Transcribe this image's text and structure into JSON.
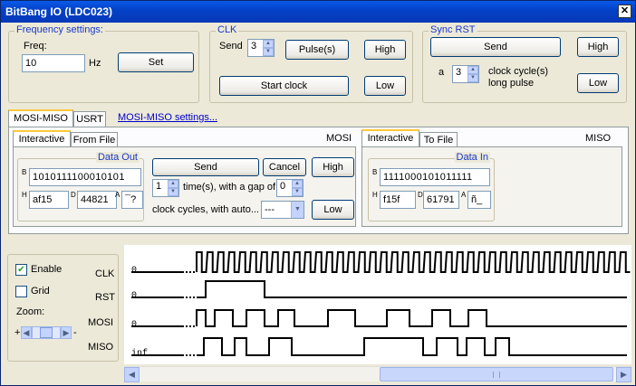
{
  "window": {
    "title": "BitBang IO (LDC023)",
    "close_glyph": "✕"
  },
  "frequency": {
    "group_title": "Frequency settings:",
    "freq_label": "Freq:",
    "freq_value": "10",
    "unit": "Hz",
    "set_label": "Set"
  },
  "clk": {
    "group_title": "CLK",
    "send_label": "Send",
    "send_count": "3",
    "pulses_label": "Pulse(s)",
    "high_label": "High",
    "start_clock_label": "Start clock",
    "low_label": "Low"
  },
  "sync_rst": {
    "group_title": "Sync RST",
    "send_label": "Send",
    "high_label": "High",
    "a_label": "a",
    "cycles_value": "3",
    "cycles_label_1": "clock cycle(s)",
    "cycles_label_2": "long pulse",
    "low_label": "Low"
  },
  "main_tabs": [
    {
      "label": "MOSI-MISO",
      "active": true
    },
    {
      "label": "USRT",
      "active": false
    }
  ],
  "settings_link": "MOSI-MISO settings...",
  "mosi": {
    "section_label": "MOSI",
    "tabs": [
      {
        "label": "Interactive",
        "active": true
      },
      {
        "label": "From File",
        "active": false
      }
    ],
    "data_out_title": "Data Out",
    "b_label": "B",
    "binary": "1010111100010101",
    "h_label": "H",
    "hex": "af15",
    "d_label": "D",
    "dec": "44821",
    "a_label": "A",
    "ascii": "¯?",
    "send_label": "Send",
    "cancel_label": "Cancel",
    "high_label": "High",
    "times_value": "1",
    "times_label": "time(s), with a gap of",
    "gap_value": "0",
    "cycles_label": "clock cycles, with auto...",
    "auto_value": "---",
    "low_label": "Low"
  },
  "miso": {
    "section_label": "MISO",
    "tabs": [
      {
        "label": "Interactive",
        "active": true
      },
      {
        "label": "To File",
        "active": false
      }
    ],
    "data_in_title": "Data In",
    "b_label": "B",
    "binary": "1111000101011111",
    "h_label": "H",
    "hex": "f15f",
    "d_label": "D",
    "dec": "61791",
    "a_label": "A",
    "ascii": "ñ_"
  },
  "view": {
    "enable_label": "Enable",
    "enable_checked": true,
    "grid_label": "Grid",
    "grid_checked": false,
    "zoom_label": "Zoom:",
    "zoom_plus": "+",
    "zoom_minus": "-"
  },
  "signals": [
    {
      "name": "CLK",
      "start": "0"
    },
    {
      "name": "RST",
      "start": "0"
    },
    {
      "name": "MOSI",
      "start": "0"
    },
    {
      "name": "MISO",
      "start": "inf"
    }
  ]
}
